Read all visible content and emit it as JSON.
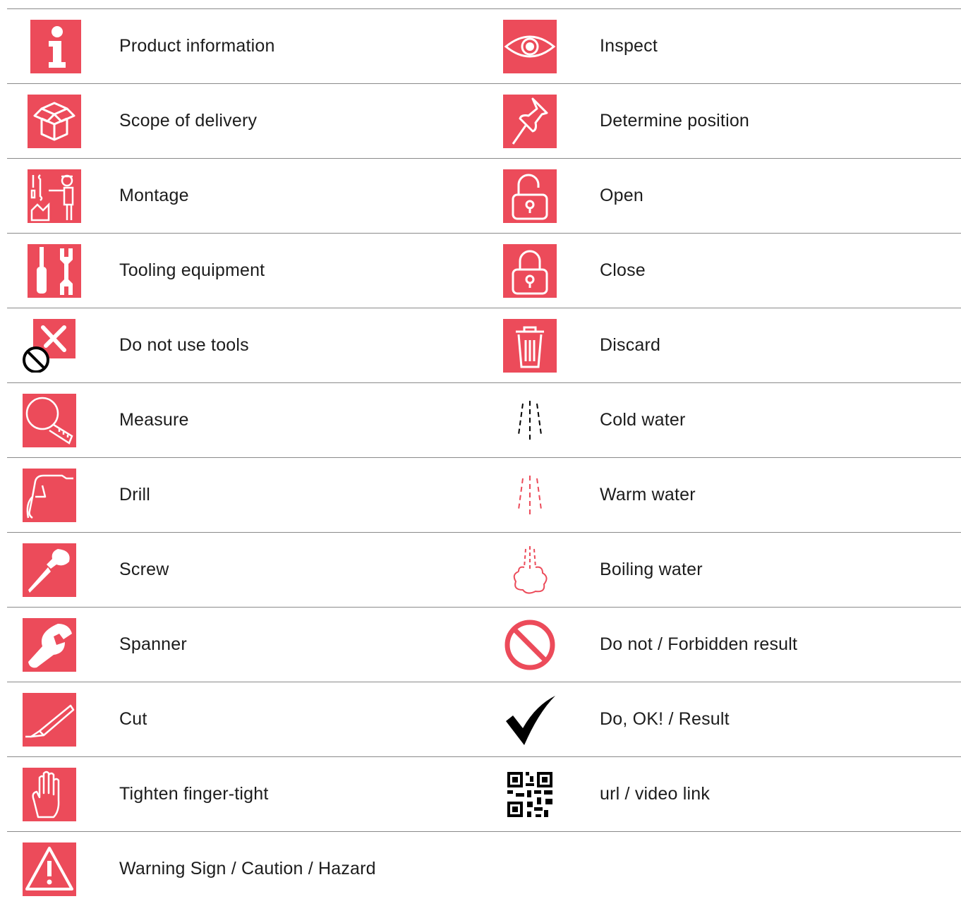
{
  "accent_color": "#ec4b5a",
  "rows": [
    {
      "left": {
        "icon": "info-icon",
        "label": "Product information"
      },
      "right": {
        "icon": "eye-icon",
        "label": "Inspect"
      }
    },
    {
      "left": {
        "icon": "open-box-icon",
        "label": "Scope of delivery"
      },
      "right": {
        "icon": "pushpin-icon",
        "label": "Determine position"
      }
    },
    {
      "left": {
        "icon": "montage-worker-icon",
        "label": "Montage"
      },
      "right": {
        "icon": "padlock-open-icon",
        "label": "Open"
      }
    },
    {
      "left": {
        "icon": "tools-icon",
        "label": "Tooling equipment"
      },
      "right": {
        "icon": "padlock-closed-icon",
        "label": "Close"
      }
    },
    {
      "left": {
        "icon": "no-tools-icon",
        "label": "Do not use tools"
      },
      "right": {
        "icon": "trash-bin-icon",
        "label": "Discard"
      }
    },
    {
      "left": {
        "icon": "tape-measure-icon",
        "label": "Measure"
      },
      "right": {
        "icon": "cold-water-icon",
        "label": "Cold water"
      }
    },
    {
      "left": {
        "icon": "drill-icon",
        "label": "Drill"
      },
      "right": {
        "icon": "warm-water-icon",
        "label": "Warm water"
      }
    },
    {
      "left": {
        "icon": "screwdriver-icon",
        "label": "Screw"
      },
      "right": {
        "icon": "boiling-water-icon",
        "label": "Boiling water"
      }
    },
    {
      "left": {
        "icon": "spanner-icon",
        "label": "Spanner"
      },
      "right": {
        "icon": "forbidden-icon",
        "label": "Do not / Forbidden result"
      }
    },
    {
      "left": {
        "icon": "cutter-knife-icon",
        "label": "Cut"
      },
      "right": {
        "icon": "checkmark-icon",
        "label": "Do, OK! / Result"
      }
    },
    {
      "left": {
        "icon": "hand-icon",
        "label": "Tighten finger-tight"
      },
      "right": {
        "icon": "qr-code-icon",
        "label": "url / video link"
      }
    },
    {
      "left": {
        "icon": "warning-triangle-icon",
        "label": "Warning Sign / Caution / Hazard"
      },
      "right": null
    }
  ]
}
